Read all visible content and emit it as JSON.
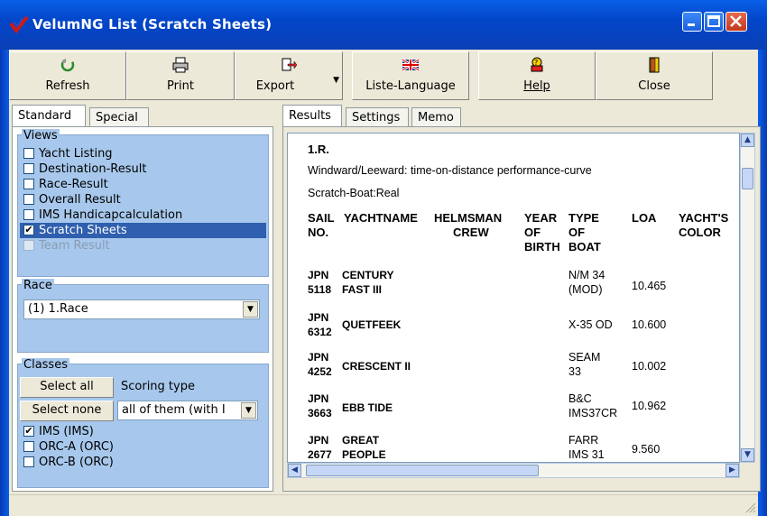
{
  "window": {
    "title": "VelumNG List (Scratch Sheets)"
  },
  "toolbar": {
    "refresh": "Refresh",
    "print": "Print",
    "export": "Export",
    "language": "Liste-Language",
    "help": "Help",
    "close": "Close"
  },
  "left_tabs": [
    "Standard",
    "Special"
  ],
  "views": {
    "legend": "Views",
    "items": [
      {
        "label": "Yacht Listing",
        "checked": false
      },
      {
        "label": "Destination-Result",
        "checked": false
      },
      {
        "label": "Race-Result",
        "checked": false
      },
      {
        "label": "Overall Result",
        "checked": false
      },
      {
        "label": "IMS Handicapcalculation",
        "checked": false
      },
      {
        "label": "Scratch Sheets",
        "checked": true
      },
      {
        "label": "Team Result",
        "checked": false
      }
    ]
  },
  "race": {
    "legend": "Race",
    "selected": "(1) 1.Race"
  },
  "classes": {
    "legend": "Classes",
    "select_all": "Select all",
    "select_none": "Select none",
    "scoring_label": "Scoring type",
    "scoring_value": "all of them (with I",
    "items": [
      {
        "label": "IMS (IMS)",
        "checked": true
      },
      {
        "label": "ORC-A (ORC)",
        "checked": false
      },
      {
        "label": "ORC-B (ORC)",
        "checked": false
      }
    ]
  },
  "right_tabs": [
    "Results",
    "Settings",
    "Memo"
  ],
  "results": {
    "heading": "1.R.",
    "subtitle": "Windward/Leeward: time-on-distance performance-curve",
    "boat_line": "Scratch-Boat:Real",
    "columns": {
      "sail_no": [
        "SAIL",
        "NO."
      ],
      "yachtname": [
        "YACHTNAME"
      ],
      "helmsman": [
        "HELMSMAN",
        "CREW"
      ],
      "year": [
        "YEAR",
        "OF",
        "BIRTH"
      ],
      "type": [
        "TYPE",
        "OF",
        "BOAT"
      ],
      "loa": [
        "LOA"
      ],
      "color": [
        "YACHT'S",
        "COLOR"
      ]
    },
    "rows": [
      {
        "sail": [
          "JPN",
          "5118"
        ],
        "name": [
          "CENTURY",
          "FAST III"
        ],
        "type": [
          "N/M 34",
          "(MOD)"
        ],
        "loa": "10.465"
      },
      {
        "sail": [
          "JPN",
          "6312"
        ],
        "name": [
          "QUETFEEK"
        ],
        "type": [
          "X-35 OD"
        ],
        "loa": "10.600"
      },
      {
        "sail": [
          "JPN",
          "4252"
        ],
        "name": [
          "CRESCENT II"
        ],
        "type": [
          "SEAM",
          "33"
        ],
        "loa": "10.002"
      },
      {
        "sail": [
          "JPN",
          "3663"
        ],
        "name": [
          "EBB TIDE"
        ],
        "type": [
          "B&C",
          "IMS37CR"
        ],
        "loa": "10.962"
      },
      {
        "sail": [
          "JPN",
          "2677"
        ],
        "name": [
          "GREAT",
          "PEOPLE"
        ],
        "type": [
          "FARR",
          "IMS 31"
        ],
        "loa": "9.560"
      }
    ]
  }
}
